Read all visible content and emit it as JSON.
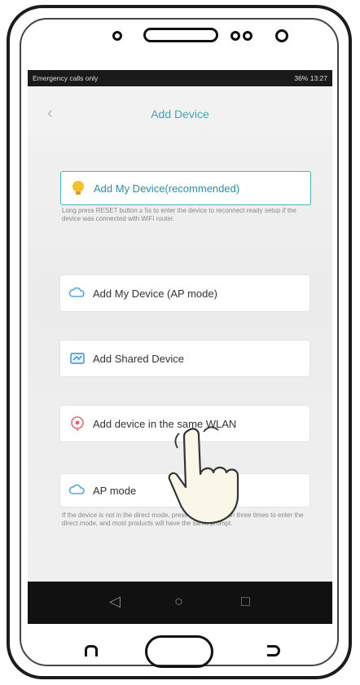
{
  "status_bar": {
    "left": "Emergency calls only",
    "right": "36% 13:27"
  },
  "header": {
    "title": "Add Device"
  },
  "options": [
    {
      "label": "Add My Device(recommended)",
      "icon": "lightbulb-icon",
      "recommended": true
    },
    {
      "label": "Add My Device (AP mode)",
      "icon": "cloud-icon"
    },
    {
      "label": "Add Shared Device",
      "icon": "share-icon"
    },
    {
      "label": "Add device in the same WLAN",
      "icon": "wlan-icon"
    },
    {
      "label": "AP mode",
      "icon": "ap-cloud-icon"
    }
  ],
  "descriptions": {
    "recommended": "Long press RESET button ≥ 5s to enter the device to reconnect ready setup if the device was connected with WiFi router.",
    "ap_mode": "If the device is not in the direct mode, press the reset button three times to enter the direct mode, and most products will have the same prompt."
  },
  "colors": {
    "accent": "#3aa8b8"
  }
}
